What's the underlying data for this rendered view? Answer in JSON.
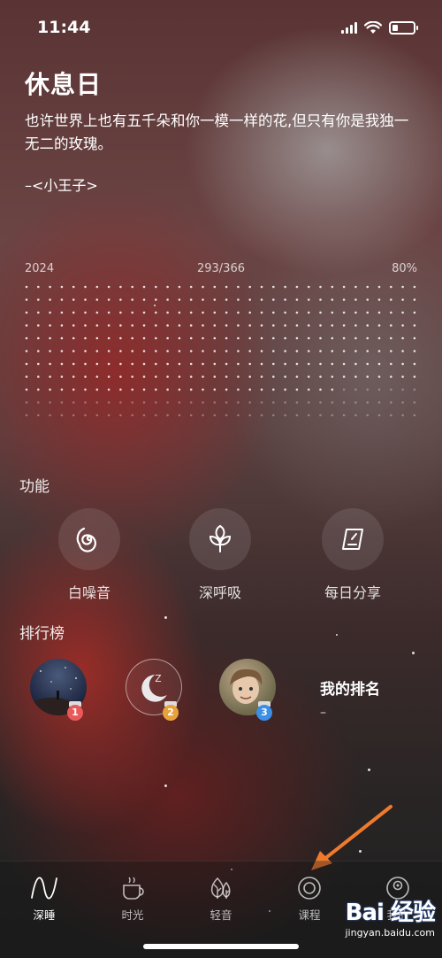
{
  "status_bar": {
    "time": "11:44"
  },
  "header": {
    "title": "休息日",
    "quote": "也许世界上也有五千朵和你一模一样的花,但只有你是我独一无二的玫瑰。",
    "author": "–<小王子>"
  },
  "progress": {
    "year": "2024",
    "count": "293/366",
    "percent": "80%",
    "fraction": 0.8
  },
  "features": {
    "title": "功能",
    "items": [
      {
        "label": "白噪音",
        "icon": "spiral-icon"
      },
      {
        "label": "深呼吸",
        "icon": "leaf-icon"
      },
      {
        "label": "每日分享",
        "icon": "share-card-icon"
      }
    ]
  },
  "ranking": {
    "title": "排行榜",
    "entries": [
      {
        "rank": "1",
        "avatar": "night-sky-avatar",
        "badge_color": "#e85a5a"
      },
      {
        "rank": "2",
        "avatar": "moon-avatar",
        "badge_color": "#e8a23b"
      },
      {
        "rank": "3",
        "avatar": "child-avatar",
        "badge_color": "#3b8fe8"
      }
    ],
    "my_rank_label": "我的排名",
    "my_rank_value": "–"
  },
  "tabs": [
    {
      "label": "深睡",
      "icon": "wave-icon",
      "active": true
    },
    {
      "label": "时光",
      "icon": "coffee-icon",
      "active": false
    },
    {
      "label": "轻音",
      "icon": "tree-icon",
      "active": false
    },
    {
      "label": "课程",
      "icon": "ring-icon",
      "active": false
    },
    {
      "label": "我的",
      "icon": "profile-icon",
      "active": false
    }
  ],
  "colors": {
    "arrow": "#f07a2c",
    "background": "#3d2b2b"
  },
  "watermark": {
    "logo": "Bai 经验",
    "url": "jingyan.baidu.com"
  }
}
